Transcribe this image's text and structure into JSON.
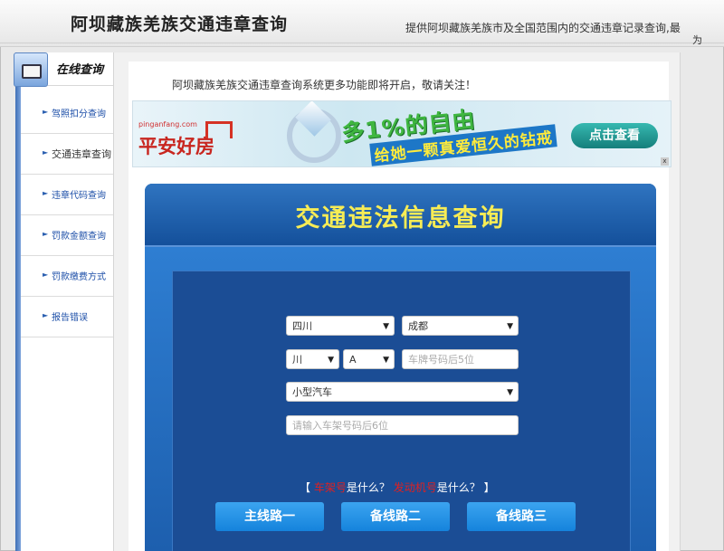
{
  "header": {
    "title": "阿坝藏族羌族交通违章查询",
    "description": "提供阿坝藏族羌族市及全国范围内的交通违章记录查询,最",
    "description_wrap": "为"
  },
  "sidebar": {
    "title": "在线查询",
    "items": [
      {
        "label": "驾照扣分查询"
      },
      {
        "label": "交通违章查询"
      },
      {
        "label": "违章代码查询"
      },
      {
        "label": "罚款金额查询"
      },
      {
        "label": "罚款缴费方式"
      },
      {
        "label": "报告错误"
      }
    ]
  },
  "notice": "阿坝藏族羌族交通违章查询系统更多功能即将开启，敬请关注！",
  "ad": {
    "brand_en": "pinganfang.com",
    "brand": "平安好房",
    "slogan1": "多1%的自由",
    "slogan2": "给她一颗真爱恒久的钻戒",
    "button": "点击查看",
    "close": "x"
  },
  "form": {
    "title": "交通违法信息查询",
    "province": "四川",
    "city": "成都",
    "plate_prefix": "川",
    "plate_letter": "A",
    "plate_placeholder": "车牌号码后5位",
    "vehicle_type": "小型汽车",
    "vin_placeholder": "请输入车架号码后6位",
    "link_open": "【",
    "link1": "车架号",
    "link1_suffix": "是什么？",
    "link2": "发动机号",
    "link2_suffix": "是什么？",
    "link_close": "】",
    "buttons": [
      "主线路一",
      "备线路二",
      "备线路三"
    ]
  },
  "colors": {
    "panel": "#1e5fa8",
    "title": "#f7ec55",
    "button": "#1f8fe6",
    "link": "#1d4fa8"
  }
}
